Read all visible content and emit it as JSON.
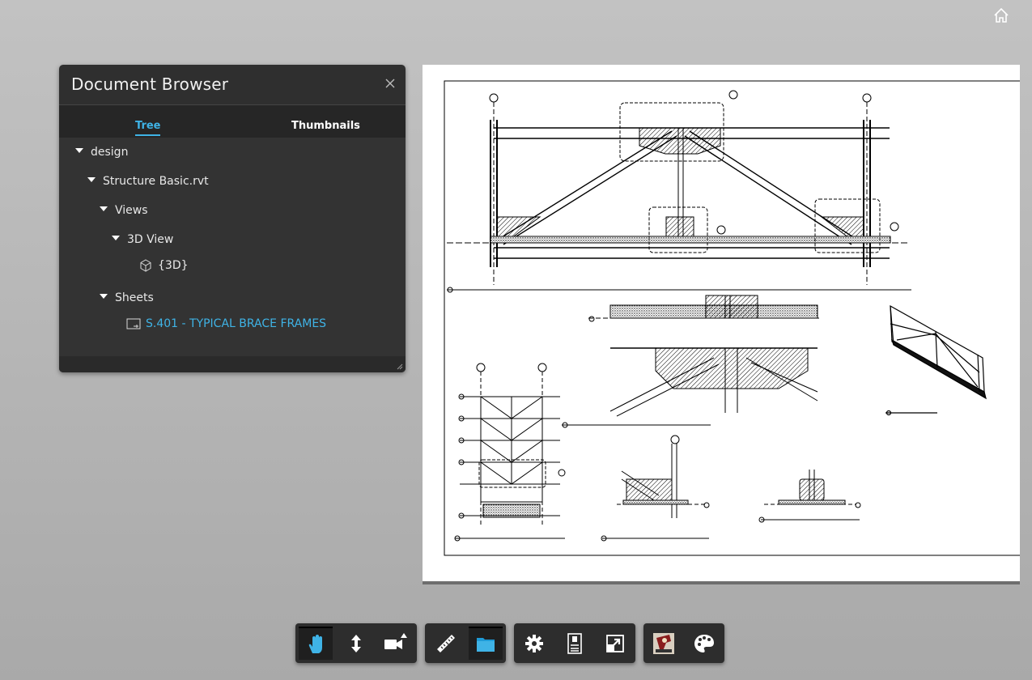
{
  "panel": {
    "title": "Document Browser",
    "tabs": [
      {
        "label": "Tree",
        "active": true
      },
      {
        "label": "Thumbnails",
        "active": false
      }
    ],
    "tree": [
      {
        "label": "design",
        "level": 0,
        "expanded": true
      },
      {
        "label": "Structure Basic.rvt",
        "level": 1,
        "expanded": true
      },
      {
        "label": "Views",
        "level": 2,
        "expanded": true
      },
      {
        "label": "3D View",
        "level": 3,
        "expanded": true
      },
      {
        "label": "{3D}",
        "level": 4,
        "icon": "cube-icon"
      },
      {
        "label": "Sheets",
        "level": 2,
        "expanded": true
      },
      {
        "label": "S.401 - TYPICAL BRACE FRAMES",
        "level": 3,
        "icon": "sheet-icon",
        "selected": true
      }
    ]
  },
  "toolbar": {
    "groups": [
      {
        "name": "navigation",
        "buttons": [
          {
            "icon": "pan-hand-icon",
            "active": true
          },
          {
            "icon": "dolly-icon",
            "active": false
          },
          {
            "icon": "camera-icon",
            "active": false,
            "has_submenu": true
          }
        ]
      },
      {
        "name": "tools",
        "buttons": [
          {
            "icon": "measure-icon",
            "active": false
          },
          {
            "icon": "document-browser-icon",
            "active": true
          }
        ]
      },
      {
        "name": "settings",
        "buttons": [
          {
            "icon": "settings-gear-icon",
            "active": false
          },
          {
            "icon": "properties-icon",
            "active": false
          },
          {
            "icon": "fullscreen-icon",
            "active": false
          }
        ]
      },
      {
        "name": "extensions",
        "buttons": [
          {
            "icon": "extension-avatar-icon",
            "active": false
          },
          {
            "icon": "palette-icon",
            "active": false
          }
        ]
      }
    ]
  },
  "colors": {
    "accent": "#3fb3e6",
    "panel_bg": "#2f2f2f",
    "toolbar_bg": "#2d2d2d"
  }
}
